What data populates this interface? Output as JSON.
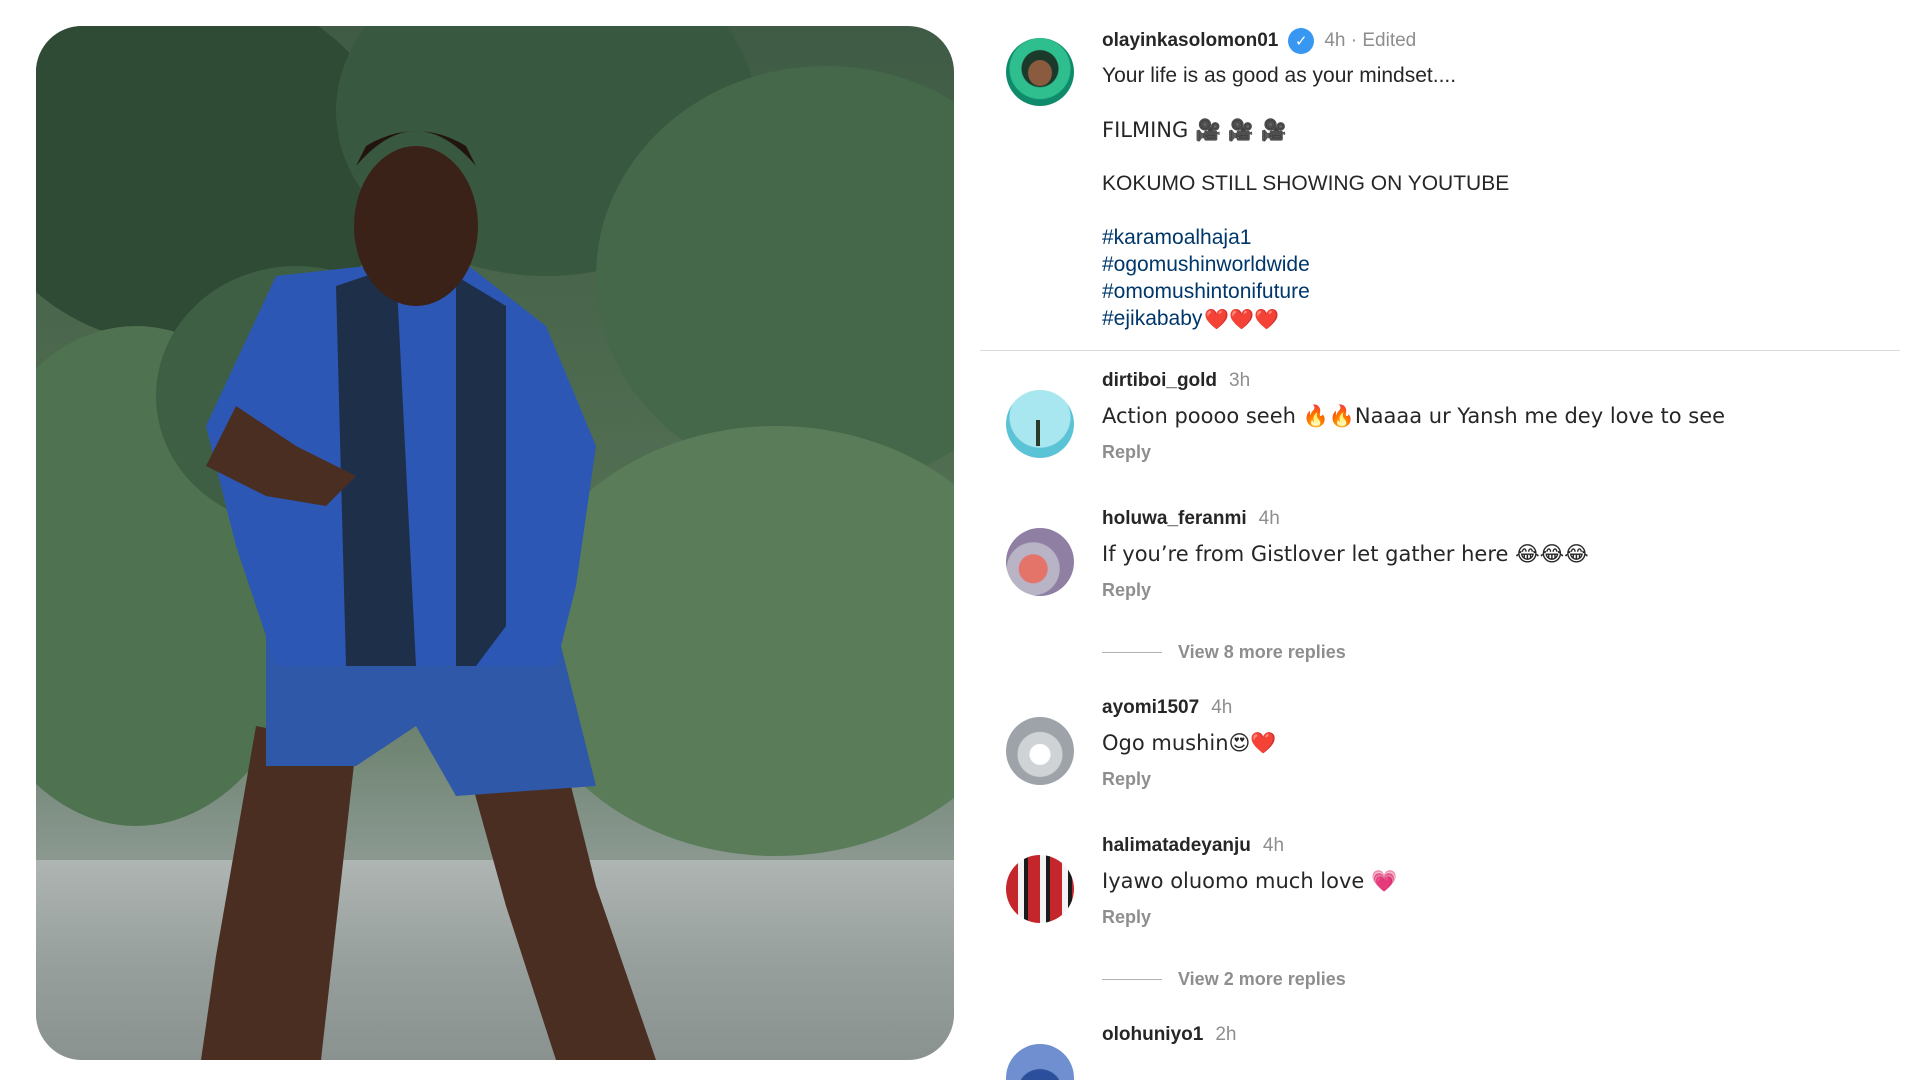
{
  "media": {
    "description_icon": "video-frame"
  },
  "caption": {
    "username": "olayinkasolomon01",
    "verified_icon": "verified-badge-icon",
    "time": "4h · Edited",
    "line1": "Your life is as good as your mindset....",
    "line2": "FILMING 🎥 🎥 🎥",
    "line3": "KOKUMO STILL SHOWING ON YOUTUBE",
    "hashtags": [
      "#karamoalhaja1",
      "#ogomushinworldwide",
      "#omomushintonifuture",
      "#ejikababy"
    ],
    "hashtag_suffix": "❤️❤️❤️"
  },
  "comments": [
    {
      "username": "dirtiboi_gold",
      "time": "3h",
      "text": "Action poooo seeh 🔥🔥Naaaa ur Yansh me dey love to see",
      "reply": "Reply"
    },
    {
      "username": "holuwa_feranmi",
      "time": "4h",
      "text": "If you’re from Gistlover let gather here 😂😂😂",
      "reply": "Reply"
    },
    {
      "username": "ayomi1507",
      "time": "4h",
      "text": "Ogo mushin😍❤️",
      "reply": "Reply"
    },
    {
      "username": "halimatadeyanju",
      "time": "4h",
      "text": "Iyawo oluomo much love 💗",
      "reply": "Reply"
    },
    {
      "username": "olohuniyo1",
      "time": "2h",
      "text": "",
      "reply": ""
    }
  ],
  "view_more": [
    {
      "label": "View 8 more replies"
    },
    {
      "label": "View 2 more replies"
    }
  ],
  "colors": {
    "username": "#262626",
    "muted": "#8e8e8e",
    "hashtag": "#00376b",
    "verified": "#3897f0"
  }
}
